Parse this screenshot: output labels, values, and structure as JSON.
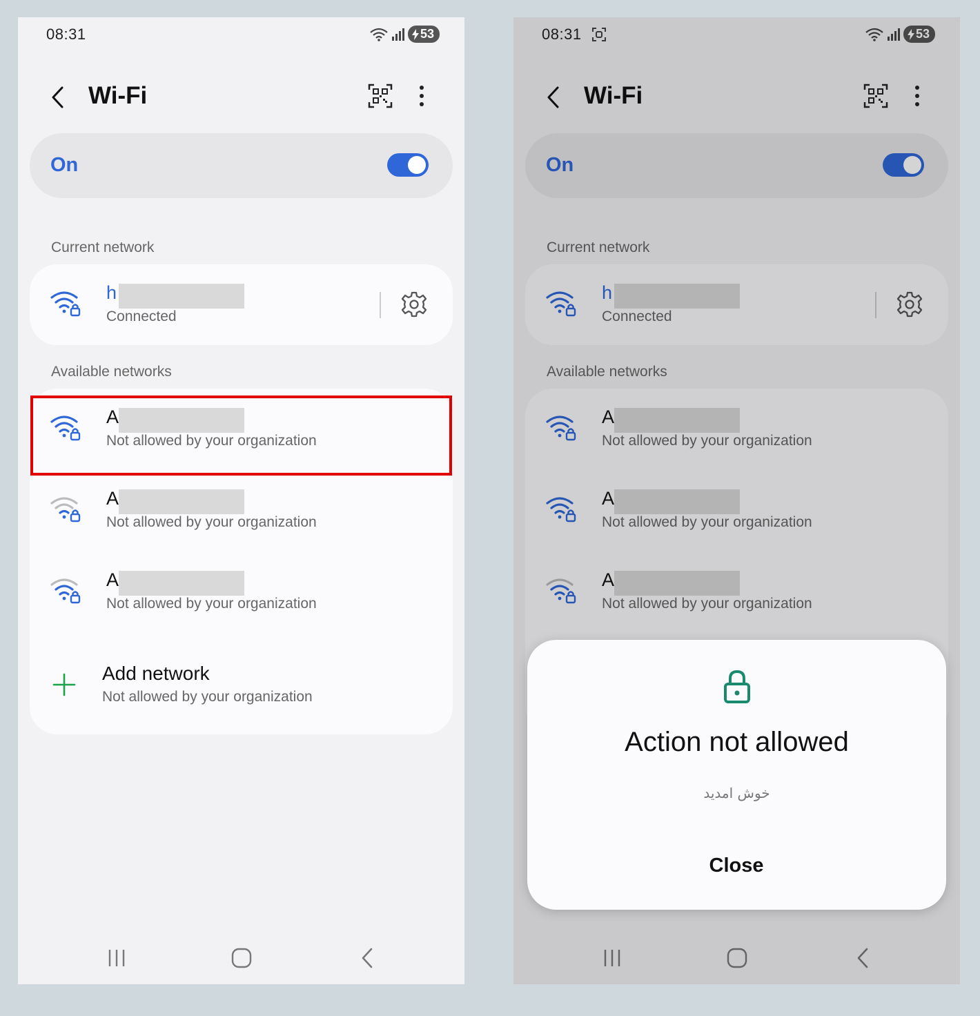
{
  "status_bar": {
    "time": "08:31",
    "battery": "53"
  },
  "header": {
    "title": "Wi-Fi"
  },
  "toggle": {
    "label": "On",
    "state": "on"
  },
  "current_section": {
    "label": "Current network"
  },
  "current_network": {
    "name_visible": "h",
    "status": "Connected"
  },
  "available_section": {
    "label": "Available networks"
  },
  "networks": [
    {
      "name_visible": "A",
      "status": "Not allowed by your organization"
    },
    {
      "name_visible": "A",
      "status": "Not allowed by your organization"
    },
    {
      "name_visible": "A",
      "status": "Not allowed by your organization"
    }
  ],
  "add_network": {
    "title": "Add network",
    "status": "Not allowed by your organization"
  },
  "dialog": {
    "title": "Action not allowed",
    "message": "خوش امدید",
    "button": "Close"
  },
  "colors": {
    "accent": "#2f67d8",
    "highlight": "#e00000",
    "lock_icon": "#1a8a6e",
    "add_icon": "#1aa34a"
  }
}
